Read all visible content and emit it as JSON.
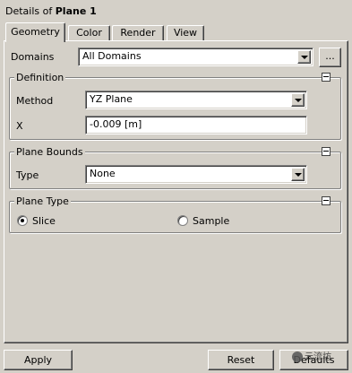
{
  "title": {
    "prefix": "Details of",
    "name": "Plane 1"
  },
  "tabs": [
    {
      "label": "Geometry",
      "active": true
    },
    {
      "label": "Color",
      "active": false
    },
    {
      "label": "Render",
      "active": false
    },
    {
      "label": "View",
      "active": false
    }
  ],
  "domains": {
    "label": "Domains",
    "value": "All Domains",
    "browse_label": "..."
  },
  "definition": {
    "title": "Definition",
    "method_label": "Method",
    "method_value": "YZ Plane",
    "x_label": "X",
    "x_value": "-0.009 [m]"
  },
  "plane_bounds": {
    "title": "Plane Bounds",
    "type_label": "Type",
    "type_value": "None"
  },
  "plane_type": {
    "title": "Plane Type",
    "options": [
      {
        "label": "Slice",
        "checked": true
      },
      {
        "label": "Sample",
        "checked": false
      }
    ]
  },
  "footer": {
    "apply": "Apply",
    "reset": "Reset",
    "defaults": "Defaults"
  },
  "watermark": "云流坊"
}
